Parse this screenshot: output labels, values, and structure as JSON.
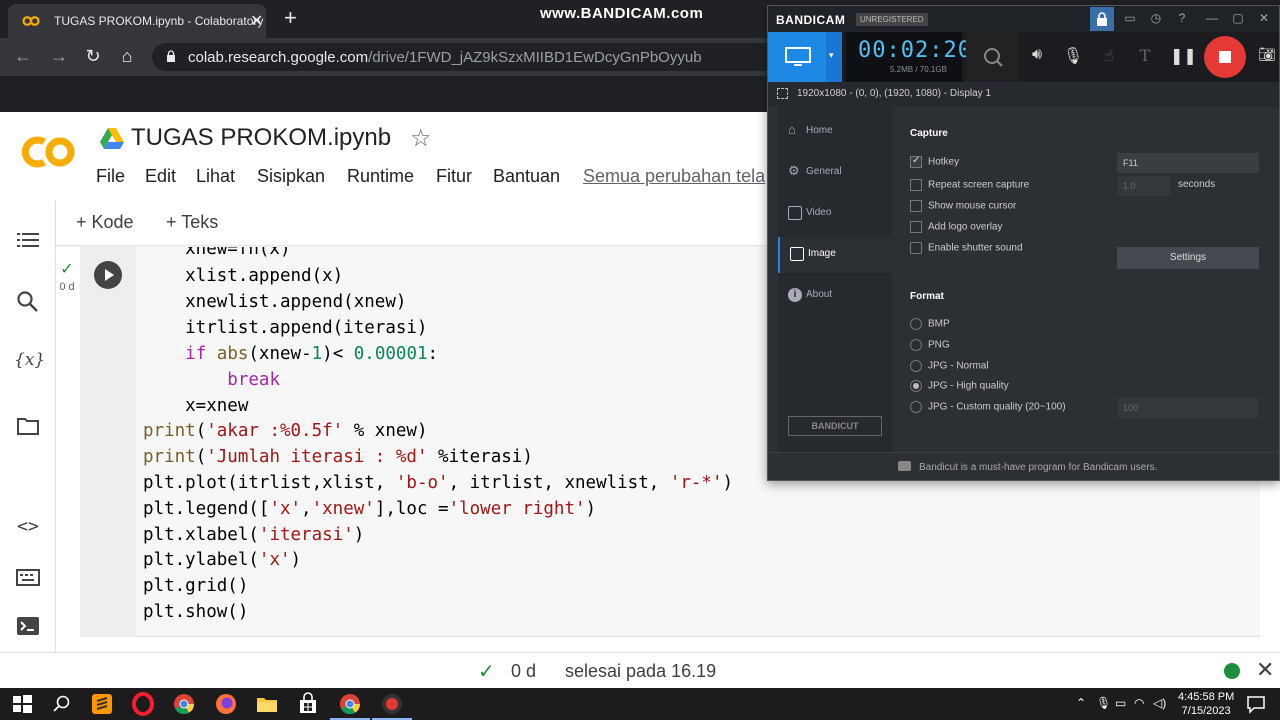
{
  "browser": {
    "tab_title": "TUGAS PROKOM.ipynb - Colaboratory",
    "url_host": "colab.research.google.com",
    "url_path": "/drive/1FWD_jAZ9kSzxMIIBD1EwDcyGnPbOyyub"
  },
  "watermark": "www.BANDICAM.com",
  "colab": {
    "title": "TUGAS PROKOM.ipynb",
    "menu": [
      "File",
      "Edit",
      "Lihat",
      "Sisipkan",
      "Runtime",
      "Fitur",
      "Bantuan"
    ],
    "save_status": "Semua perubahan tela",
    "toolbar": {
      "add_code": "Kode",
      "add_text": "Teks"
    },
    "cell_exec_count": "0 d",
    "status_time": "0 d",
    "status_message": "selesai pada 16.19"
  },
  "bandicam": {
    "brand": "BANDICAM",
    "unregistered": "UNREGISTERED",
    "timer": "00:02:20",
    "size": "5.2MB / 70.1GB",
    "display_info": "1920x1080 - (0, 0), (1920, 1080) - Display 1",
    "nav": [
      "Home",
      "General",
      "Video",
      "Image",
      "About"
    ],
    "capture": {
      "heading": "Capture",
      "hotkey_label": "Hotkey",
      "hotkey_value": "F11",
      "repeat_label": "Repeat screen capture",
      "repeat_value": "1.0",
      "repeat_unit": "seconds",
      "cursor_label": "Show mouse cursor",
      "logo_label": "Add logo overlay",
      "shutter_label": "Enable shutter sound",
      "settings_button": "Settings"
    },
    "format": {
      "heading": "Format",
      "options": [
        "BMP",
        "PNG",
        "JPG - Normal",
        "JPG - High quality",
        "JPG - Custom quality (20~100)"
      ],
      "selected": "JPG - High quality",
      "quality_value": "100"
    },
    "bandicut_button": "BANDICUT",
    "footer": "Bandicut is a must-have program for Bandicam users."
  },
  "taskbar": {
    "time": "4:45:58 PM",
    "date": "7/15/2023"
  }
}
